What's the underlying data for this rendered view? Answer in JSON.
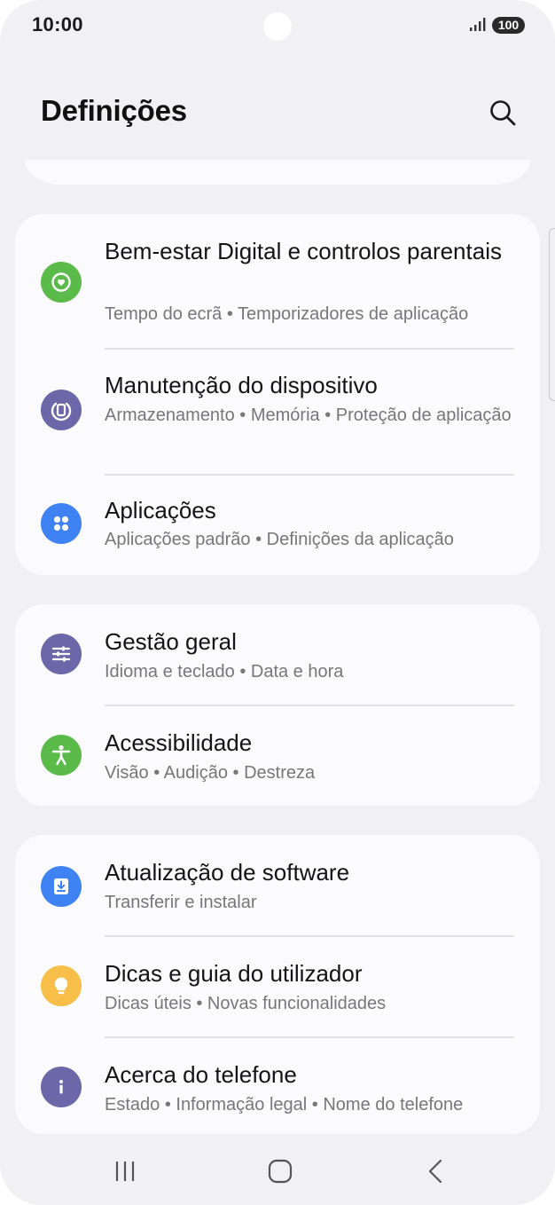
{
  "status_bar": {
    "time": "10:00",
    "battery": "100"
  },
  "header": {
    "title": "Definições"
  },
  "cards": [
    {
      "items": [
        {
          "title": "Bem-estar Digital e controlos parentais",
          "subtitle": "Tempo do ecrã  •  Temporizadores de aplicação",
          "icon": "digital-wellbeing-icon",
          "color": "#5bbb4a"
        },
        {
          "title": "Manutenção do dispositivo",
          "subtitle": "Armazenamento  •  Memória  •  Proteção de aplicação",
          "icon": "device-care-icon",
          "color": "#6b67a8"
        },
        {
          "title": "Aplicações",
          "subtitle": "Aplicações padrão  •  Definições da aplicação",
          "icon": "apps-icon",
          "color": "#3f82f4"
        }
      ]
    },
    {
      "items": [
        {
          "title": "Gestão geral",
          "subtitle": "Idioma e teclado  •  Data e hora",
          "icon": "sliders-icon",
          "color": "#6b67a8"
        },
        {
          "title": "Acessibilidade",
          "subtitle": "Visão  •  Audição  •  Destreza",
          "icon": "accessibility-icon",
          "color": "#5bbb4a"
        }
      ]
    },
    {
      "items": [
        {
          "title": "Atualização de software",
          "subtitle": "Transferir e instalar",
          "icon": "software-update-icon",
          "color": "#3f82f4"
        },
        {
          "title": "Dicas e guia do utilizador",
          "subtitle": "Dicas úteis  •  Novas funcionalidades",
          "icon": "lightbulb-icon",
          "color": "#f7be4a"
        },
        {
          "title": "Acerca do telefone",
          "subtitle": "Estado  •  Informação legal  •  Nome do telefone",
          "icon": "info-icon",
          "color": "#6b67a8"
        }
      ]
    }
  ],
  "nav": {
    "items": [
      "recents-icon",
      "home-icon",
      "back-icon"
    ]
  }
}
